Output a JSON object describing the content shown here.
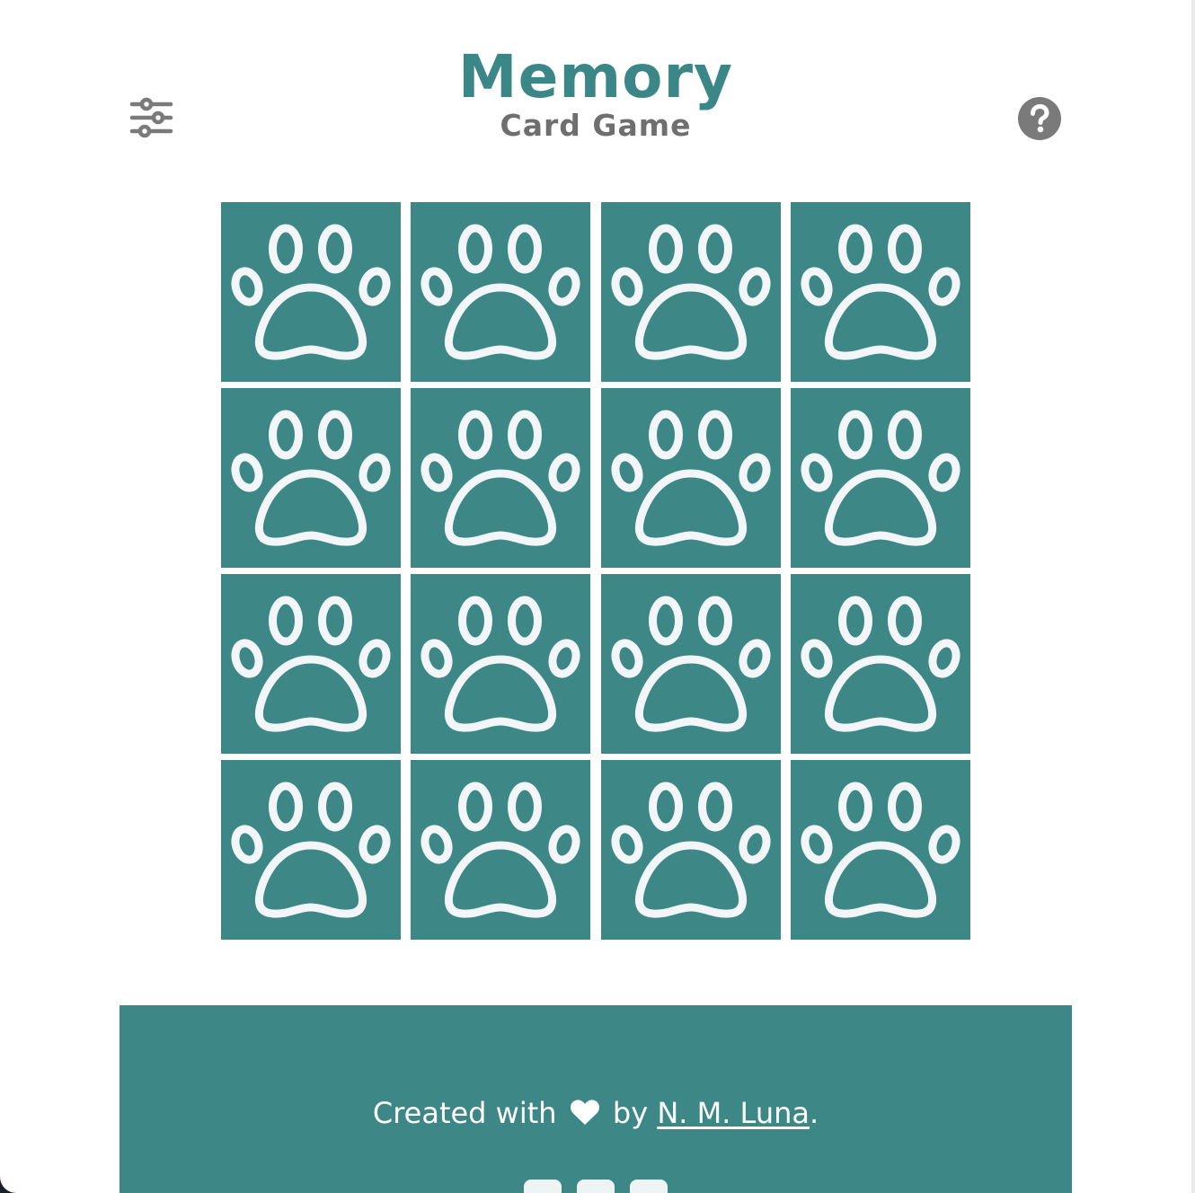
{
  "header": {
    "title": "Memory",
    "subtitle": "Card Game",
    "settings_icon": "sliders-icon",
    "help_icon": "help-icon"
  },
  "board": {
    "rows": 4,
    "columns": 4,
    "card_back_icon": "paw-icon",
    "card_color": "#3d8787"
  },
  "footer": {
    "credit_prefix": "Created with",
    "credit_middle": "by",
    "author": "N. M. Luna",
    "credit_suffix": ".",
    "social_icons": [
      "twitter-icon",
      "linkedin-icon",
      "github-icon"
    ]
  },
  "colors": {
    "accent": "#3b8787",
    "subtitle": "#6f6f6f",
    "icon_gray": "#7a7a7a"
  }
}
